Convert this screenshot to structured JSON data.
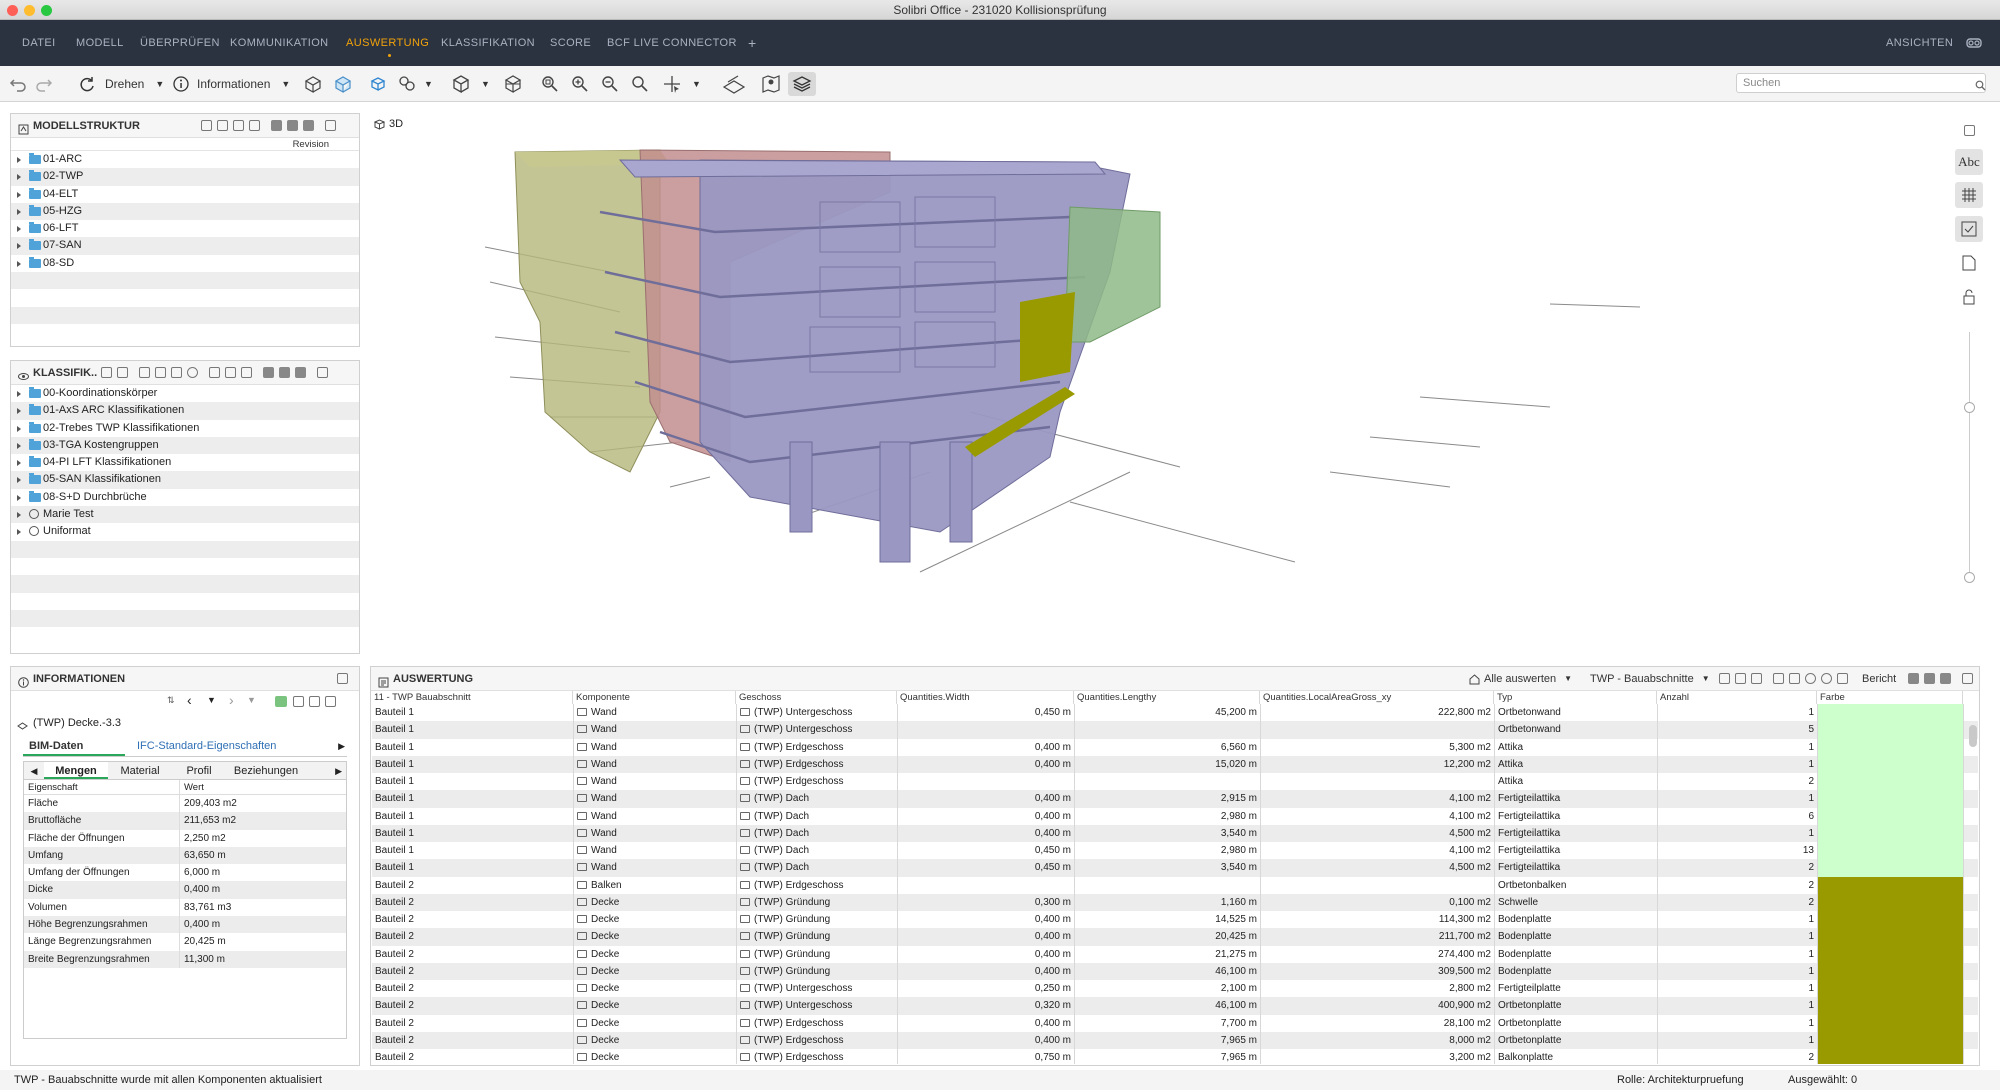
{
  "window": {
    "title": "Solibri Office - 231020 Kollisionsprüfung"
  },
  "menu": {
    "items": [
      "DATEI",
      "MODELL",
      "ÜBERPRÜFEN",
      "KOMMUNIKATION",
      "AUSWERTUNG",
      "KLASSIFIKATION",
      "SCORE",
      "BCF LIVE CONNECTOR",
      "+"
    ],
    "active": "AUSWERTUNG",
    "right_label": "ANSICHTEN"
  },
  "toolbar": {
    "rotate_label": "Drehen",
    "info_label": "Informationen",
    "search_placeholder": "Suchen"
  },
  "model_structure": {
    "title": "MODELLSTRUKTUR",
    "column_label": "Revision",
    "items": [
      "01-ARC",
      "02-TWP",
      "04-ELT",
      "05-HZG",
      "06-LFT",
      "07-SAN",
      "08-SD"
    ]
  },
  "classification": {
    "title": "KLASSIFIK..",
    "items": [
      "00-Koordinationskörper",
      "01-AxS ARC Klassifikationen",
      "02-Trebes TWP Klassifikationen",
      "03-TGA Kostengruppen",
      "04-PI LFT Klassifikationen",
      "05-SAN Klassifikationen",
      "08-S+D Durchbrüche",
      "Marie Test",
      "Uniformat"
    ]
  },
  "viewport": {
    "label": "3D"
  },
  "right_toolbar": {
    "abc_label": "Abc"
  },
  "info_panel": {
    "title": "INFORMATIONEN",
    "selected_item": "(TWP) Decke.-3.3",
    "tabs": [
      "BIM-Daten",
      "IFC-Standard-Eigenschaften"
    ],
    "subtabs": [
      "Mengen",
      "Material",
      "Profil",
      "Beziehungen"
    ],
    "columns": [
      "Eigenschaft",
      "Wert"
    ],
    "properties": [
      {
        "name": "Fläche",
        "value": "209,403 m2"
      },
      {
        "name": "Bruttofläche",
        "value": "211,653 m2"
      },
      {
        "name": "Fläche der Öffnungen",
        "value": "2,250 m2"
      },
      {
        "name": "Umfang",
        "value": "63,650 m"
      },
      {
        "name": "Umfang der Öffnungen",
        "value": "6,000 m"
      },
      {
        "name": "Dicke",
        "value": "0,400 m"
      },
      {
        "name": "Volumen",
        "value": "83,761 m3"
      },
      {
        "name": "Höhe Begrenzungsrahmen",
        "value": "0,400 m"
      },
      {
        "name": "Länge Begrenzungsrahmen",
        "value": "20,425 m"
      },
      {
        "name": "Breite Begrenzungsrahmen",
        "value": "11,300 m"
      }
    ]
  },
  "evaluation": {
    "title": "AUSWERTUNG",
    "evaluate_all_label": "Alle auswerten",
    "template_label": "TWP - Bauabschnitte",
    "report_label": "Bericht",
    "columns": [
      "11 - TWP Bauabschnitt",
      "Komponente",
      "Geschoss",
      "Quantities.Width",
      "Quantities.Lengthy",
      "Quantities.LocalAreaGross_xy",
      "Typ",
      "Anzahl",
      "Farbe"
    ],
    "colors": {
      "Bauteil 1": "#ccffcc",
      "Bauteil 2": "#999900"
    },
    "rows": [
      [
        "Bauteil 1",
        "Wand",
        "(TWP) Untergeschoss",
        "0,450 m",
        "45,200 m",
        "222,800 m2",
        "Ortbetonwand",
        "1"
      ],
      [
        "Bauteil 1",
        "Wand",
        "(TWP) Untergeschoss",
        "",
        "",
        "",
        "Ortbetonwand",
        "5"
      ],
      [
        "Bauteil 1",
        "Wand",
        "(TWP) Erdgeschoss",
        "0,400 m",
        "6,560 m",
        "5,300 m2",
        "Attika",
        "1"
      ],
      [
        "Bauteil 1",
        "Wand",
        "(TWP) Erdgeschoss",
        "0,400 m",
        "15,020 m",
        "12,200 m2",
        "Attika",
        "1"
      ],
      [
        "Bauteil 1",
        "Wand",
        "(TWP) Erdgeschoss",
        "",
        "",
        "",
        "Attika",
        "2"
      ],
      [
        "Bauteil 1",
        "Wand",
        "(TWP) Dach",
        "0,400 m",
        "2,915 m",
        "4,100 m2",
        "Fertigteilattika",
        "1"
      ],
      [
        "Bauteil 1",
        "Wand",
        "(TWP) Dach",
        "0,400 m",
        "2,980 m",
        "4,100 m2",
        "Fertigteilattika",
        "6"
      ],
      [
        "Bauteil 1",
        "Wand",
        "(TWP) Dach",
        "0,400 m",
        "3,540 m",
        "4,500 m2",
        "Fertigteilattika",
        "1"
      ],
      [
        "Bauteil 1",
        "Wand",
        "(TWP) Dach",
        "0,450 m",
        "2,980 m",
        "4,100 m2",
        "Fertigteilattika",
        "13"
      ],
      [
        "Bauteil 1",
        "Wand",
        "(TWP) Dach",
        "0,450 m",
        "3,540 m",
        "4,500 m2",
        "Fertigteilattika",
        "2"
      ],
      [
        "Bauteil 2",
        "Balken",
        "(TWP) Erdgeschoss",
        "",
        "",
        "",
        "Ortbetonbalken",
        "2"
      ],
      [
        "Bauteil 2",
        "Decke",
        "(TWP) Gründung",
        "0,300 m",
        "1,160 m",
        "0,100 m2",
        "Schwelle",
        "2"
      ],
      [
        "Bauteil 2",
        "Decke",
        "(TWP) Gründung",
        "0,400 m",
        "14,525 m",
        "114,300 m2",
        "Bodenplatte",
        "1"
      ],
      [
        "Bauteil 2",
        "Decke",
        "(TWP) Gründung",
        "0,400 m",
        "20,425 m",
        "211,700 m2",
        "Bodenplatte",
        "1"
      ],
      [
        "Bauteil 2",
        "Decke",
        "(TWP) Gründung",
        "0,400 m",
        "21,275 m",
        "274,400 m2",
        "Bodenplatte",
        "1"
      ],
      [
        "Bauteil 2",
        "Decke",
        "(TWP) Gründung",
        "0,400 m",
        "46,100 m",
        "309,500 m2",
        "Bodenplatte",
        "1"
      ],
      [
        "Bauteil 2",
        "Decke",
        "(TWP) Untergeschoss",
        "0,250 m",
        "2,100 m",
        "2,800 m2",
        "Fertigteilplatte",
        "1"
      ],
      [
        "Bauteil 2",
        "Decke",
        "(TWP) Untergeschoss",
        "0,320 m",
        "46,100 m",
        "400,900 m2",
        "Ortbetonplatte",
        "1"
      ],
      [
        "Bauteil 2",
        "Decke",
        "(TWP) Erdgeschoss",
        "0,400 m",
        "7,700 m",
        "28,100 m2",
        "Ortbetonplatte",
        "1"
      ],
      [
        "Bauteil 2",
        "Decke",
        "(TWP) Erdgeschoss",
        "0,400 m",
        "7,965 m",
        "8,000 m2",
        "Ortbetonplatte",
        "1"
      ],
      [
        "Bauteil 2",
        "Decke",
        "(TWP) Erdgeschoss",
        "0,750 m",
        "7,965 m",
        "3,200 m2",
        "Balkonplatte",
        "2"
      ]
    ]
  },
  "status": {
    "message": "TWP - Bauabschnitte wurde mit allen Komponenten aktualisiert",
    "role": "Rolle: Architekturpruefung",
    "selected": "Ausgewählt: 0"
  }
}
